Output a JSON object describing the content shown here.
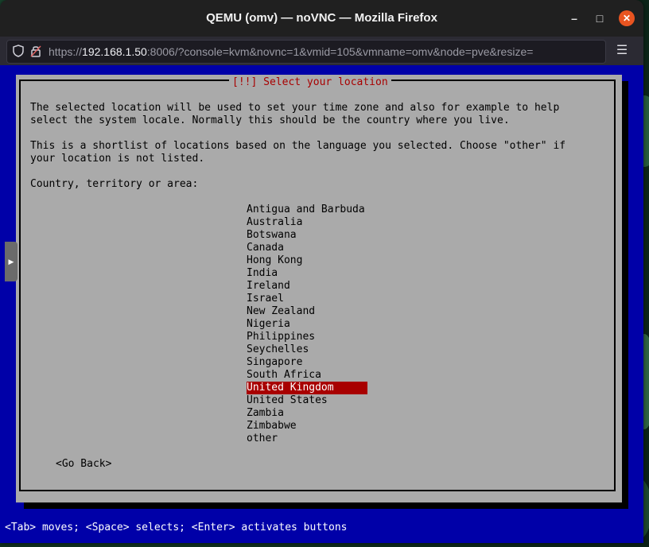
{
  "window": {
    "title": "QEMU (omv) — noVNC — Mozilla Firefox",
    "minimize_icon": "minimize-icon",
    "maximize_icon": "maximize-icon",
    "close_icon": "close-icon"
  },
  "browser": {
    "url_prefix": "https://",
    "url_host": "192.168.1.50",
    "url_rest": ":8006/?console=kvm&novnc=1&vmid=105&vmname=omv&node=pve&resize=",
    "menu_icon": "hamburger-menu-icon"
  },
  "dialog": {
    "title": "[!!] Select your location",
    "desc1_line1": "The selected location will be used to set your time zone and also for example to help",
    "desc1_line2": "select the system locale. Normally this should be the country where you live.",
    "desc2_line1": "This is a shortlist of locations based on the language you selected. Choose \"other\" if",
    "desc2_line2": "your location is not listed.",
    "prompt": "Country, territory or area:",
    "options": [
      "Antigua and Barbuda",
      "Australia",
      "Botswana",
      "Canada",
      "Hong Kong",
      "India",
      "Ireland",
      "Israel",
      "New Zealand",
      "Nigeria",
      "Philippines",
      "Seychelles",
      "Singapore",
      "South Africa",
      "United Kingdom",
      "United States",
      "Zambia",
      "Zimbabwe",
      "other"
    ],
    "selected_option": "United Kingdom",
    "go_back": "<Go Back>"
  },
  "status_hint": "<Tab> moves; <Space> selects; <Enter> activates buttons",
  "colors": {
    "console_bg": "#0000a8",
    "dialog_bg": "#aaaaaa",
    "selection_bg": "#a80000",
    "title_red": "#a80000"
  }
}
